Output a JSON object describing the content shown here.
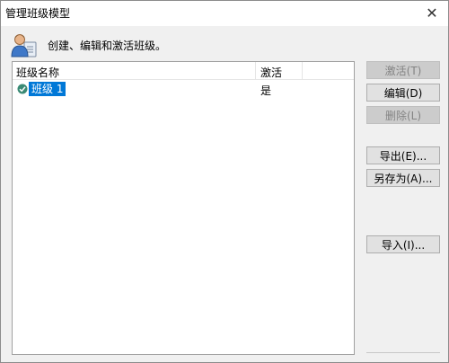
{
  "window": {
    "title": "管理班级模型",
    "close_glyph": "✕"
  },
  "header": {
    "text": "创建、编辑和激活班级。",
    "icon": "user-icon"
  },
  "table": {
    "columns": [
      "班级名称",
      "激活"
    ],
    "rows": [
      {
        "name": "班级 1",
        "active": "是",
        "selected": true,
        "status_icon": "check-icon"
      }
    ]
  },
  "buttons": {
    "activate": "激活(T)",
    "edit": "编辑(D)",
    "delete": "删除(L)",
    "export": "导出(E)...",
    "save_as": "另存为(A)...",
    "import": "导入(I)..."
  },
  "colors": {
    "selection": "#0078d7",
    "status_ok": "#3a8a75",
    "disabled_text": "#838383"
  }
}
